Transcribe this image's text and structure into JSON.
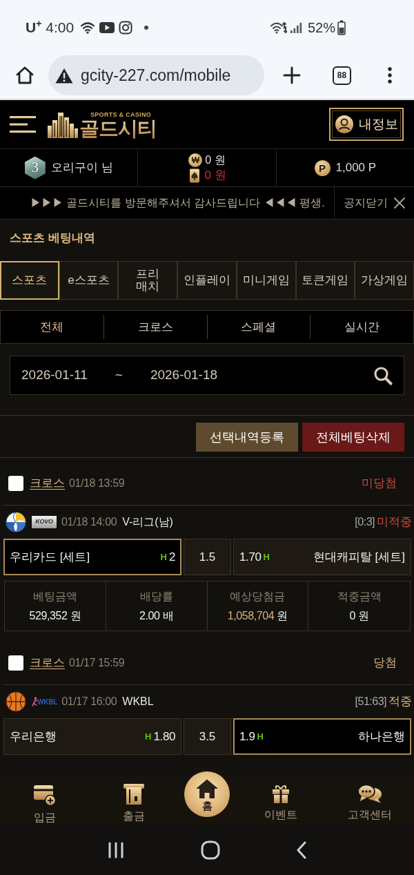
{
  "status_bar": {
    "carrier": "U$^{+}$",
    "time": "4:00",
    "battery": "52%"
  },
  "browser": {
    "url": "gcity-227.com/mobile",
    "tab_count": "88"
  },
  "header": {
    "tagline": "SPORTS & CASINO",
    "logo": "골드시티",
    "profile_button": "내정보"
  },
  "account": {
    "level": "3",
    "user": "오리구이 님",
    "cash": {
      "symbol": "₩",
      "amount": "0 원"
    },
    "casino_money": "0 원",
    "points": {
      "symbol": "P",
      "amount": "1,000 P"
    }
  },
  "notice": {
    "text": "▶▶▶ 골드시티를 방문해주셔서 감사드립니다 ◀◀◀ 평생.",
    "close_label": "공지닫기"
  },
  "title": "스포츠 베팅내역",
  "tabs": [
    {
      "label": "스포츠",
      "selected": true
    },
    {
      "label": "e스포츠",
      "selected": false
    },
    {
      "label": "프리\n매치",
      "selected": false
    },
    {
      "label": "인플레이",
      "selected": false
    },
    {
      "label": "미니게임",
      "selected": false
    },
    {
      "label": "토큰게임",
      "selected": false
    },
    {
      "label": "가상게임",
      "selected": false
    }
  ],
  "filters": [
    {
      "label": "전체",
      "selected": true
    },
    {
      "label": "크로스",
      "selected": false
    },
    {
      "label": "스페셜",
      "selected": false
    },
    {
      "label": "실시간",
      "selected": false
    }
  ],
  "date_range": {
    "from": "2026-01-11",
    "separator": "~",
    "to": "2026-01-18"
  },
  "actions": [
    {
      "label": "선택내역등록",
      "kind": "register"
    },
    {
      "label": "전체베팅삭제",
      "kind": "delete"
    }
  ],
  "bets": [
    {
      "checked": false,
      "type": "크로스",
      "placed": "01/18 13:59",
      "result": "미당첨",
      "won": false,
      "games": [
        {
          "kind": "volleyball",
          "logo": {
            "kind": "plate",
            "text": "KOVO"
          },
          "time": "01/18 14:00",
          "league": "V-리그(남)",
          "score": "[0:3]",
          "result": "미적중",
          "hit": false,
          "home": {
            "team": "우리카드 [세트]",
            "mark": "H",
            "odds": "2",
            "selected": true
          },
          "line": "1.5",
          "away": {
            "team": "현대캐피탈 [세트]",
            "mark": "H",
            "odds": "1.70",
            "selected": false
          }
        }
      ],
      "summary": [
        {
          "label": "베팅금액",
          "amount": "529,352",
          "unit": "원",
          "highlight": false
        },
        {
          "label": "배당률",
          "amount": "2.00",
          "unit": "배",
          "highlight": false
        },
        {
          "label": "예상당첨금",
          "amount": "1,058,704",
          "unit": "원",
          "highlight": true
        },
        {
          "label": "적중금액",
          "amount": "0",
          "unit": "원",
          "highlight": false
        }
      ]
    },
    {
      "checked": false,
      "type": "크로스",
      "placed": "01/17 15:59",
      "result": "당첨",
      "won": true,
      "games": [
        {
          "kind": "basketball",
          "logo": {
            "kind": "plain",
            "text": "WKBL"
          },
          "time": "01/17 16:00",
          "league": "WKBL",
          "score": "[51:63]",
          "result": "적중",
          "hit": true,
          "home": {
            "team": "우리은행",
            "mark": "H",
            "odds": "1.80",
            "selected": false
          },
          "line": "3.5",
          "away": {
            "team": "하나은행",
            "mark": "H",
            "odds": "1.9",
            "selected": true
          }
        }
      ]
    }
  ],
  "bottom_nav": [
    {
      "label": "입금",
      "kind": "deposit"
    },
    {
      "label": "출금",
      "kind": "withdraw"
    },
    {
      "label": "홈",
      "kind": "home"
    },
    {
      "label": "이벤트",
      "kind": "event"
    },
    {
      "label": "고객센터",
      "kind": "support"
    }
  ]
}
